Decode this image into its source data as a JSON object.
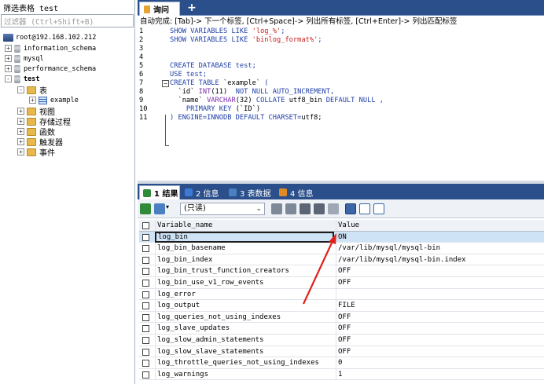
{
  "left_panel": {
    "filter_title": "筛选表格 test",
    "filter_placeholder": "过滤器 (Ctrl+Shift+B)",
    "tree": [
      {
        "label": "root@192.168.102.212",
        "icon": "server-icon"
      },
      {
        "label": "information_schema",
        "icon": "database-icon",
        "expander": "+"
      },
      {
        "label": "mysql",
        "icon": "database-icon",
        "expander": "+"
      },
      {
        "label": "performance_schema",
        "icon": "database-icon",
        "expander": "+"
      },
      {
        "label": "test",
        "icon": "database-icon",
        "expander": "-"
      },
      {
        "label": "表",
        "icon": "folder-icon",
        "expander": "-"
      },
      {
        "label": "example",
        "icon": "table-icon",
        "expander": "+"
      },
      {
        "label": "视图",
        "icon": "folder-icon",
        "expander": "+"
      },
      {
        "label": "存储过程",
        "icon": "folder-icon",
        "expander": "+"
      },
      {
        "label": "函数",
        "icon": "folder-icon",
        "expander": "+"
      },
      {
        "label": "触发器",
        "icon": "folder-icon",
        "expander": "+"
      },
      {
        "label": "事件",
        "icon": "folder-icon",
        "expander": "+"
      }
    ]
  },
  "editor": {
    "tab_label": "询问",
    "add_tab": "+",
    "hint": "自动完成: [Tab]-> 下一个标签, [Ctrl+Space]-> 列出所有标签, [Ctrl+Enter]-> 列出匹配标签",
    "lines": [
      {
        "n": "1",
        "parts": [
          [
            "kw",
            "SHOW VARIABLES LIKE "
          ],
          [
            "str",
            "'log_%'"
          ],
          [
            "kw",
            ";"
          ]
        ]
      },
      {
        "n": "2",
        "parts": [
          [
            "kw",
            "SHOW VARIABLES LIKE "
          ],
          [
            "str",
            "'binlog_format%'"
          ],
          [
            "kw",
            ";"
          ]
        ]
      },
      {
        "n": "3",
        "parts": []
      },
      {
        "n": "4",
        "parts": []
      },
      {
        "n": "5",
        "parts": [
          [
            "kw",
            "CREATE DATABASE test;"
          ]
        ]
      },
      {
        "n": "6",
        "parts": [
          [
            "kw",
            "USE test;"
          ]
        ]
      },
      {
        "n": "7",
        "parts": [
          [
            "kw",
            "CREATE TABLE "
          ],
          [
            "nm",
            "`example`"
          ],
          [
            "kw",
            " ("
          ]
        ]
      },
      {
        "n": "8",
        "parts": [
          [
            "nm",
            "  `id` "
          ],
          [
            "ty",
            "INT"
          ],
          [
            "nm",
            "(11)  "
          ],
          [
            "kw",
            "NOT NULL AUTO_INCREMENT,"
          ]
        ]
      },
      {
        "n": "9",
        "parts": [
          [
            "nm",
            "  `name` "
          ],
          [
            "ty",
            "VARCHAR"
          ],
          [
            "nm",
            "(32) "
          ],
          [
            "kw",
            "COLLATE "
          ],
          [
            "nm",
            "utf8_bin "
          ],
          [
            "kw",
            "DEFAULT NULL ,"
          ]
        ]
      },
      {
        "n": "10",
        "parts": [
          [
            "kw",
            "    PRIMARY KEY "
          ],
          [
            "nm",
            "(`ID`)"
          ]
        ]
      },
      {
        "n": "11",
        "parts": [
          [
            "kw",
            ") ENGINE=INNODB DEFAULT CHARSET="
          ],
          [
            "nm",
            "utf8;"
          ]
        ]
      }
    ]
  },
  "result_tabs": [
    {
      "label": "1 结果",
      "icon": "grid-icon",
      "active": true,
      "color": "#2f8a3a"
    },
    {
      "label": "2 信息",
      "icon": "info-icon",
      "active": false,
      "color": "#3c7ad6"
    },
    {
      "label": "3 表数据",
      "icon": "table-data-icon",
      "active": false,
      "color": "#4a7fc2"
    },
    {
      "label": "4 信息",
      "icon": "chart-icon",
      "active": false,
      "color": "#e08a26"
    }
  ],
  "toolbar": {
    "readonly_option": "(只读)"
  },
  "grid": {
    "headers": [
      "Variable_name",
      "Value"
    ],
    "rows": [
      [
        "log_bin",
        "ON"
      ],
      [
        "log_bin_basename",
        "/var/lib/mysql/mysql-bin"
      ],
      [
        "log_bin_index",
        "/var/lib/mysql/mysql-bin.index"
      ],
      [
        "log_bin_trust_function_creators",
        "OFF"
      ],
      [
        "log_bin_use_v1_row_events",
        "OFF"
      ],
      [
        "log_error",
        ""
      ],
      [
        "log_output",
        "FILE"
      ],
      [
        "log_queries_not_using_indexes",
        "OFF"
      ],
      [
        "log_slave_updates",
        "OFF"
      ],
      [
        "log_slow_admin_statements",
        "OFF"
      ],
      [
        "log_slow_slave_statements",
        "OFF"
      ],
      [
        "log_throttle_queries_not_using_indexes",
        "0"
      ],
      [
        "log_warnings",
        "1"
      ]
    ],
    "selected_row": 0
  },
  "colors": {
    "accent": "#2a4f8a",
    "selected_row": "#cfe3f7",
    "annotation_arrow": "#e0201a"
  }
}
